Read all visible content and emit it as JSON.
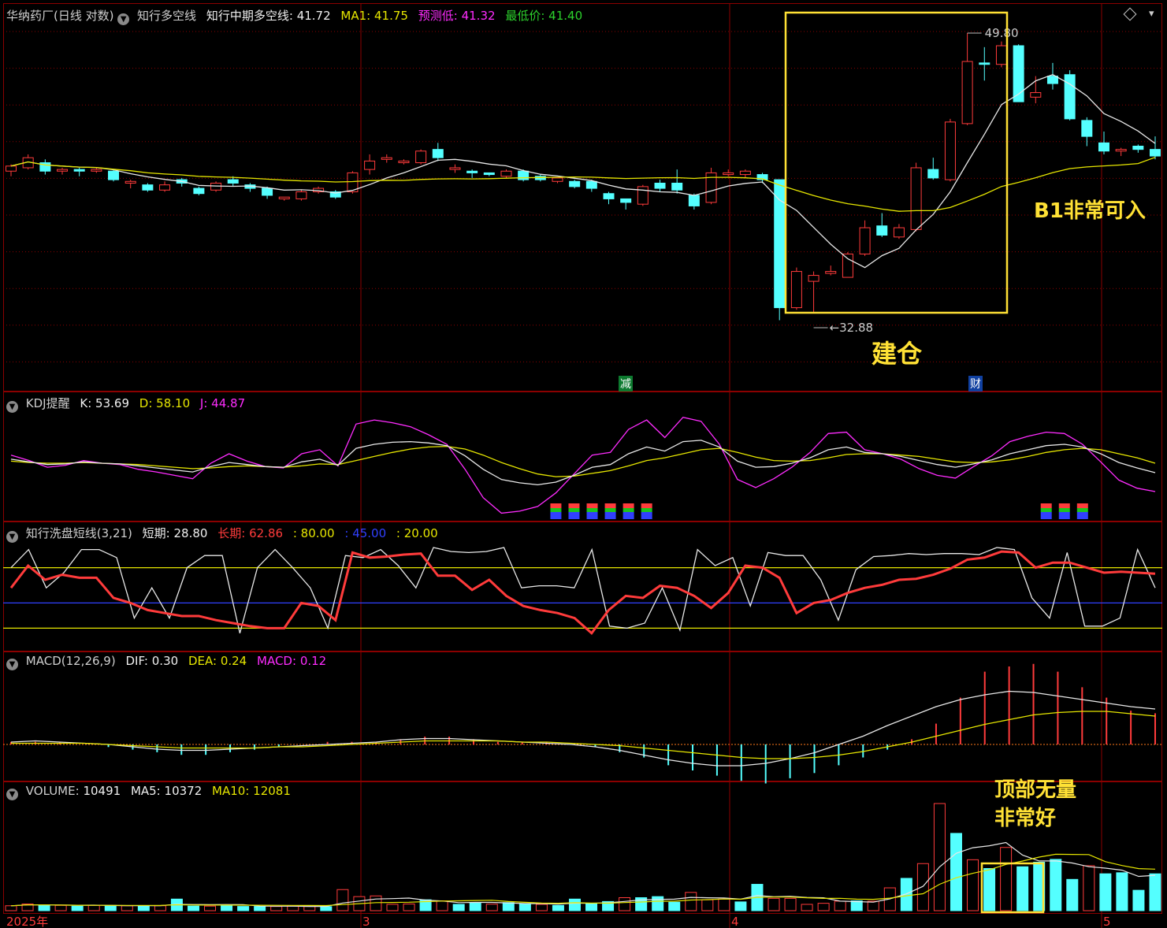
{
  "colors": {
    "up": "#ff3b3b",
    "down": "#54ffff",
    "white": "#e8e8e8",
    "yellow": "#e6e600",
    "magenta": "#ff2cff",
    "blue": "#3040ff",
    "grid": "#8b0000",
    "annotation": "#ffe135",
    "green_label": "#2cd12c"
  },
  "main_header": {
    "stock": "华纳药厂(日线 对数)",
    "indicator1": "知行多空线",
    "mid_label": "知行中期多空线:",
    "mid_value": "41.72",
    "ma1_label": "MA1:",
    "ma1_value": "41.75",
    "pred_label": "预测低:",
    "pred_value": "41.32",
    "low_label": "最低价:",
    "low_value": "41.40"
  },
  "kdj_header": {
    "name": "KDJ提醒",
    "k_label": "K:",
    "k": "53.69",
    "d_label": "D:",
    "d": "58.10",
    "j_label": "J:",
    "j": "44.87"
  },
  "wash_header": {
    "name": "知行洗盘短线(3,21)",
    "short_label": "短期:",
    "short": "28.80",
    "long_label": "长期:",
    "long": "62.86",
    "l80": ": 80.00",
    "l45": ": 45.00",
    "l20": ": 20.00"
  },
  "macd_header": {
    "name": "MACD(12,26,9)",
    "dif_label": "DIF:",
    "dif": "0.30",
    "dea_label": "DEA:",
    "dea": "0.24",
    "macd_label": "MACD:",
    "macd": "0.12"
  },
  "vol_header": {
    "name": "VOLUME:",
    "vol": "10491",
    "ma5_label": "MA5:",
    "ma5": "10372",
    "ma10_label": "MA10:",
    "ma10": "12081"
  },
  "annotations": {
    "build": "建仓",
    "b1": "B1非常可入",
    "top_line1": "顶部无量",
    "top_line2": "非常好"
  },
  "markers": {
    "reduce": "减",
    "finance": "财"
  },
  "x_axis_labels": [
    "2025年",
    "3",
    "4",
    "5"
  ],
  "chart_data": {
    "type": "candlestick",
    "x_ticks": [
      "2025年",
      "3",
      "4",
      "5"
    ],
    "extremes": {
      "high": "49.80",
      "low": "32.88"
    },
    "candles": [
      [
        40.8,
        41.1,
        40.5,
        41.2
      ],
      [
        41.0,
        41.6,
        40.9,
        41.8
      ],
      [
        41.3,
        40.8,
        40.6,
        41.5
      ],
      [
        40.8,
        40.9,
        40.6,
        41.0
      ],
      [
        40.9,
        40.8,
        40.5,
        41.0
      ],
      [
        40.8,
        40.9,
        40.7,
        41.0
      ],
      [
        40.8,
        40.3,
        40.2,
        40.9
      ],
      [
        40.1,
        40.2,
        39.8,
        40.3
      ],
      [
        40.0,
        39.7,
        39.6,
        40.1
      ],
      [
        39.7,
        40.0,
        39.6,
        40.2
      ],
      [
        40.3,
        40.1,
        39.9,
        40.4
      ],
      [
        39.8,
        39.5,
        39.4,
        39.9
      ],
      [
        39.7,
        40.1,
        39.6,
        40.2
      ],
      [
        40.3,
        40.1,
        39.9,
        40.5
      ],
      [
        40.0,
        39.8,
        39.6,
        40.1
      ],
      [
        39.8,
        39.4,
        39.2,
        39.9
      ],
      [
        39.2,
        39.3,
        39.1,
        39.3
      ],
      [
        39.2,
        39.6,
        39.1,
        39.7
      ],
      [
        39.6,
        39.8,
        39.5,
        39.9
      ],
      [
        39.6,
        39.3,
        39.2,
        39.7
      ],
      [
        39.6,
        40.7,
        39.5,
        40.8
      ],
      [
        40.9,
        41.4,
        40.6,
        41.8
      ],
      [
        41.5,
        41.6,
        41.3,
        41.8
      ],
      [
        41.3,
        41.4,
        41.2,
        41.5
      ],
      [
        41.3,
        42.0,
        41.2,
        42.1
      ],
      [
        42.1,
        41.6,
        41.4,
        42.5
      ],
      [
        40.9,
        41.0,
        40.7,
        41.2
      ],
      [
        40.8,
        40.7,
        40.4,
        40.9
      ],
      [
        40.7,
        40.6,
        40.5,
        40.7
      ],
      [
        40.5,
        40.8,
        40.4,
        40.9
      ],
      [
        40.8,
        40.3,
        40.2,
        40.9
      ],
      [
        40.5,
        40.3,
        40.2,
        40.6
      ],
      [
        40.2,
        40.4,
        40.1,
        40.4
      ],
      [
        40.2,
        39.9,
        39.8,
        40.3
      ],
      [
        40.2,
        39.8,
        39.6,
        40.3
      ],
      [
        39.5,
        39.2,
        38.9,
        39.6
      ],
      [
        39.2,
        39.0,
        38.6,
        39.2
      ],
      [
        38.9,
        39.9,
        38.8,
        40.0
      ],
      [
        40.1,
        39.8,
        39.6,
        40.3
      ],
      [
        40.1,
        39.7,
        39.5,
        40.9
      ],
      [
        39.4,
        38.8,
        38.6,
        39.5
      ],
      [
        39.0,
        40.7,
        38.9,
        41.0
      ],
      [
        40.6,
        40.7,
        40.5,
        40.9
      ],
      [
        40.6,
        40.8,
        40.4,
        40.9
      ],
      [
        40.6,
        40.3,
        40.1,
        40.7
      ],
      [
        40.3,
        33.5,
        32.9,
        40.3
      ],
      [
        33.5,
        35.3,
        33.4,
        35.5
      ],
      [
        34.8,
        35.1,
        33.3,
        35.3
      ],
      [
        35.2,
        35.3,
        35.1,
        35.6
      ],
      [
        35.0,
        36.2,
        35.0,
        36.3
      ],
      [
        36.2,
        37.6,
        36.1,
        38.0
      ],
      [
        37.7,
        37.2,
        37.1,
        38.4
      ],
      [
        37.1,
        37.6,
        37.0,
        37.8
      ],
      [
        37.5,
        41.0,
        37.4,
        41.3
      ],
      [
        40.9,
        40.4,
        40.3,
        41.6
      ],
      [
        40.3,
        43.8,
        40.2,
        44.0
      ],
      [
        43.7,
        47.8,
        43.6,
        49.8
      ],
      [
        47.7,
        47.6,
        46.5,
        48.8
      ],
      [
        47.6,
        48.9,
        47.4,
        49.2
      ],
      [
        48.9,
        45.1,
        45.1,
        49.0
      ],
      [
        45.4,
        45.7,
        45.0,
        46.8
      ],
      [
        46.8,
        46.3,
        45.9,
        47.7
      ],
      [
        46.9,
        44.0,
        43.9,
        47.2
      ],
      [
        43.9,
        42.9,
        42.3,
        44.1
      ],
      [
        42.5,
        42.0,
        41.8,
        43.2
      ],
      [
        42.0,
        42.1,
        41.7,
        42.2
      ],
      [
        42.3,
        42.1,
        41.9,
        42.4
      ],
      [
        42.1,
        41.7,
        41.5,
        42.9
      ]
    ],
    "volume": [
      1400,
      1900,
      1600,
      1500,
      1300,
      1500,
      1500,
      1400,
      1350,
      1400,
      3300,
      1300,
      1300,
      1500,
      1200,
      1200,
      1200,
      1300,
      1200,
      1150,
      6000,
      4000,
      4200,
      1800,
      1900,
      3100,
      2800,
      1800,
      2200,
      1850,
      2300,
      1900,
      1800,
      1500,
      3300,
      2000,
      2600,
      3700,
      3700,
      4000,
      2400,
      5200,
      3100,
      3300,
      2500,
      7500,
      3500,
      3500,
      1800,
      2100,
      2700,
      2800,
      2700,
      6500,
      9200,
      13400,
      30500,
      22000,
      14500,
      12000,
      18000,
      12500,
      13800,
      14600,
      8900,
      12800,
      10500,
      10800,
      5800,
      10491
    ],
    "kdj": {
      "K": [
        60,
        56,
        52,
        53,
        56,
        54,
        53,
        50,
        47,
        44,
        41,
        49,
        55,
        52,
        49,
        48,
        56,
        60,
        51,
        76,
        82,
        85,
        86,
        84,
        80,
        65,
        45,
        30,
        25,
        22,
        26,
        36,
        48,
        52,
        68,
        78,
        72,
        86,
        88,
        78,
        57,
        48,
        49,
        54,
        62,
        74,
        78,
        70,
        68,
        64,
        58,
        52,
        48,
        53,
        59,
        68,
        74,
        80,
        82,
        78,
        68,
        55,
        47,
        40
      ],
      "D": [
        57,
        55,
        54,
        54,
        55,
        54,
        53,
        52,
        50,
        48,
        46,
        47,
        49,
        50,
        49,
        48,
        50,
        53,
        52,
        58,
        64,
        70,
        75,
        78,
        79,
        75,
        66,
        55,
        46,
        38,
        34,
        35,
        39,
        43,
        50,
        58,
        62,
        68,
        74,
        76,
        70,
        63,
        58,
        57,
        58,
        62,
        67,
        68,
        68,
        66,
        64,
        60,
        56,
        55,
        56,
        59,
        64,
        70,
        74,
        76,
        74,
        68,
        62,
        54
      ],
      "J": [
        66,
        58,
        48,
        51,
        58,
        54,
        52,
        45,
        41,
        36,
        31,
        54,
        68,
        57,
        49,
        47,
        68,
        74,
        50,
        112,
        118,
        114,
        108,
        96,
        82,
        45,
        3,
        -20,
        -17,
        -10,
        10,
        38,
        66,
        70,
        104,
        118,
        92,
        122,
        116,
        82,
        30,
        18,
        31,
        48,
        70,
        98,
        100,
        74,
        68,
        60,
        46,
        36,
        32,
        49,
        65,
        86,
        94,
        100,
        98,
        82,
        56,
        29,
        17,
        12
      ],
      "marks": [
        30,
        31,
        32,
        33,
        34,
        35,
        57,
        58,
        59
      ]
    },
    "wash": {
      "short": [
        80,
        98,
        60,
        75,
        98,
        98,
        90,
        30,
        60,
        30,
        80,
        92,
        92,
        15,
        80,
        98,
        80,
        60,
        20,
        92,
        90,
        98,
        82,
        60,
        100,
        96,
        95,
        96,
        100,
        60,
        62,
        62,
        60,
        98,
        22,
        20,
        25,
        60,
        18,
        98,
        82,
        90,
        42,
        95,
        92,
        92,
        68,
        28,
        78,
        91,
        92,
        94,
        93,
        94,
        94,
        93,
        100,
        98,
        50,
        30,
        95,
        22,
        22,
        30,
        98,
        60
      ],
      "long": [
        60,
        82,
        68,
        73,
        70,
        70,
        50,
        45,
        38,
        35,
        32,
        32,
        28,
        25,
        22,
        20,
        20,
        45,
        42,
        28,
        95,
        90,
        91,
        93,
        94,
        72,
        72,
        58,
        68,
        52,
        42,
        38,
        35,
        30,
        15,
        38,
        52,
        50,
        62,
        60,
        52,
        40,
        55,
        82,
        80,
        70,
        35,
        45,
        48,
        55,
        60,
        63,
        68,
        69,
        73,
        79,
        88,
        90,
        96,
        95,
        80,
        85,
        85,
        80,
        75,
        76,
        75,
        74
      ]
    },
    "macd": {
      "hist": [
        0.01,
        0.01,
        0.01,
        0.0,
        -0.01,
        -0.02,
        -0.03,
        -0.04,
        -0.04,
        -0.03,
        -0.02,
        -0.01,
        0.0,
        0.01,
        0.01,
        0.01,
        0.02,
        0.03,
        0.03,
        0.02,
        0.01,
        0.01,
        0.01,
        0.0,
        -0.01,
        -0.03,
        -0.05,
        -0.08,
        -0.1,
        -0.12,
        -0.14,
        -0.15,
        -0.13,
        -0.11,
        -0.08,
        -0.05,
        -0.02,
        0.02,
        0.08,
        0.18,
        0.28,
        0.3,
        0.31,
        0.28,
        0.22,
        0.18,
        0.13,
        0.12
      ],
      "dif": [
        0.02,
        0.03,
        0.02,
        0.01,
        0.0,
        -0.02,
        -0.04,
        -0.05,
        -0.05,
        -0.04,
        -0.03,
        -0.02,
        -0.01,
        0.0,
        0.01,
        0.02,
        0.04,
        0.05,
        0.05,
        0.04,
        0.03,
        0.02,
        0.01,
        0.0,
        -0.02,
        -0.05,
        -0.09,
        -0.13,
        -0.16,
        -0.18,
        -0.18,
        -0.16,
        -0.12,
        -0.07,
        0.0,
        0.07,
        0.16,
        0.24,
        0.32,
        0.38,
        0.42,
        0.45,
        0.44,
        0.41,
        0.38,
        0.35,
        0.32,
        0.3
      ],
      "dea": [
        0.01,
        0.01,
        0.01,
        0.01,
        0.0,
        -0.01,
        -0.02,
        -0.03,
        -0.03,
        -0.03,
        -0.03,
        -0.02,
        -0.02,
        -0.01,
        0.0,
        0.01,
        0.02,
        0.03,
        0.03,
        0.03,
        0.03,
        0.02,
        0.02,
        0.01,
        0.0,
        -0.01,
        -0.03,
        -0.05,
        -0.07,
        -0.09,
        -0.11,
        -0.12,
        -0.12,
        -0.11,
        -0.09,
        -0.06,
        -0.02,
        0.02,
        0.07,
        0.12,
        0.17,
        0.21,
        0.25,
        0.27,
        0.28,
        0.28,
        0.26,
        0.24
      ]
    }
  }
}
